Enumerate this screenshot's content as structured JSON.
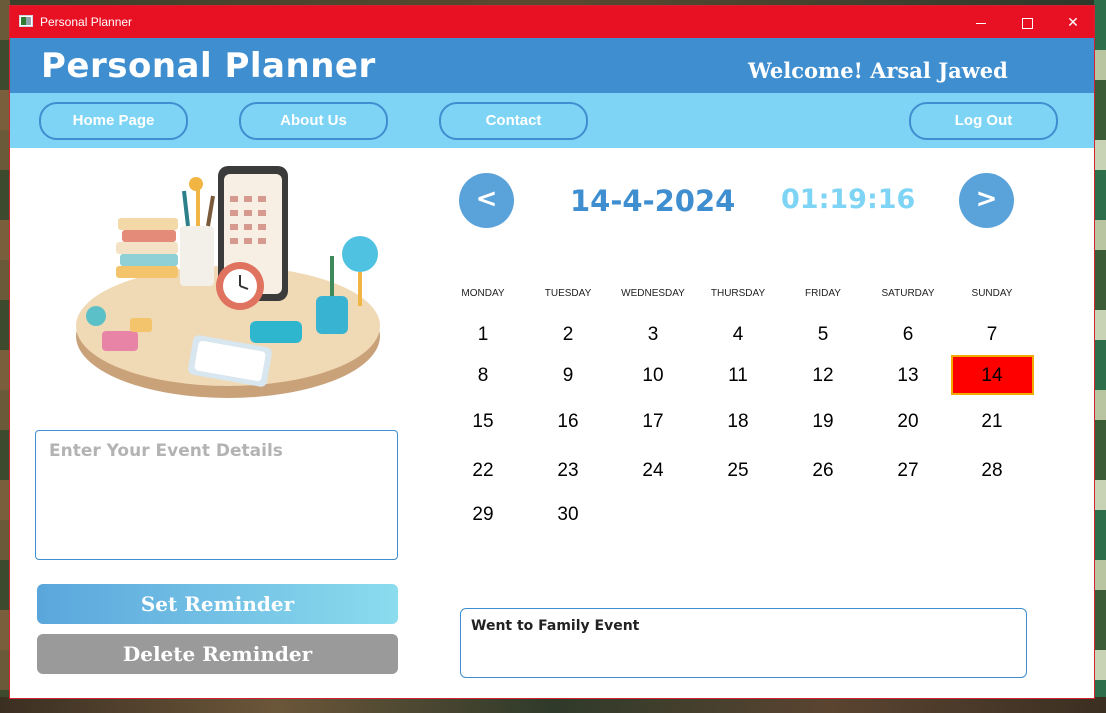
{
  "window": {
    "title": "Personal Planner"
  },
  "header": {
    "app_title": "Personal Planner",
    "welcome": "Welcome! Arsal Jawed"
  },
  "nav": {
    "home": "Home Page",
    "about": "About Us",
    "contact": "Contact",
    "logout": "Log Out"
  },
  "event": {
    "placeholder": "Enter Your Event Details"
  },
  "buttons": {
    "set_reminder": "Set Reminder",
    "delete_reminder": "Delete Reminder"
  },
  "calendar": {
    "prev": "<",
    "next": ">",
    "date": "14-4-2024",
    "time": "01:19:16",
    "weekdays": [
      "MONDAY",
      "TUESDAY",
      "WEDNESDAY",
      "THURSDAY",
      "FRIDAY",
      "SATURDAY",
      "SUNDAY"
    ],
    "days": [
      "1",
      "2",
      "3",
      "4",
      "5",
      "6",
      "7",
      "8",
      "9",
      "10",
      "11",
      "12",
      "13",
      "14",
      "15",
      "16",
      "17",
      "18",
      "19",
      "20",
      "21",
      "22",
      "23",
      "24",
      "25",
      "26",
      "27",
      "28",
      "29",
      "30"
    ],
    "selected_day": "14",
    "selected_color": "#ff0000"
  },
  "note": {
    "text": "Went to Family Event"
  },
  "colors": {
    "title_bar": "#e81123",
    "header": "#3e8ed0",
    "nav": "#7dd4f4"
  }
}
